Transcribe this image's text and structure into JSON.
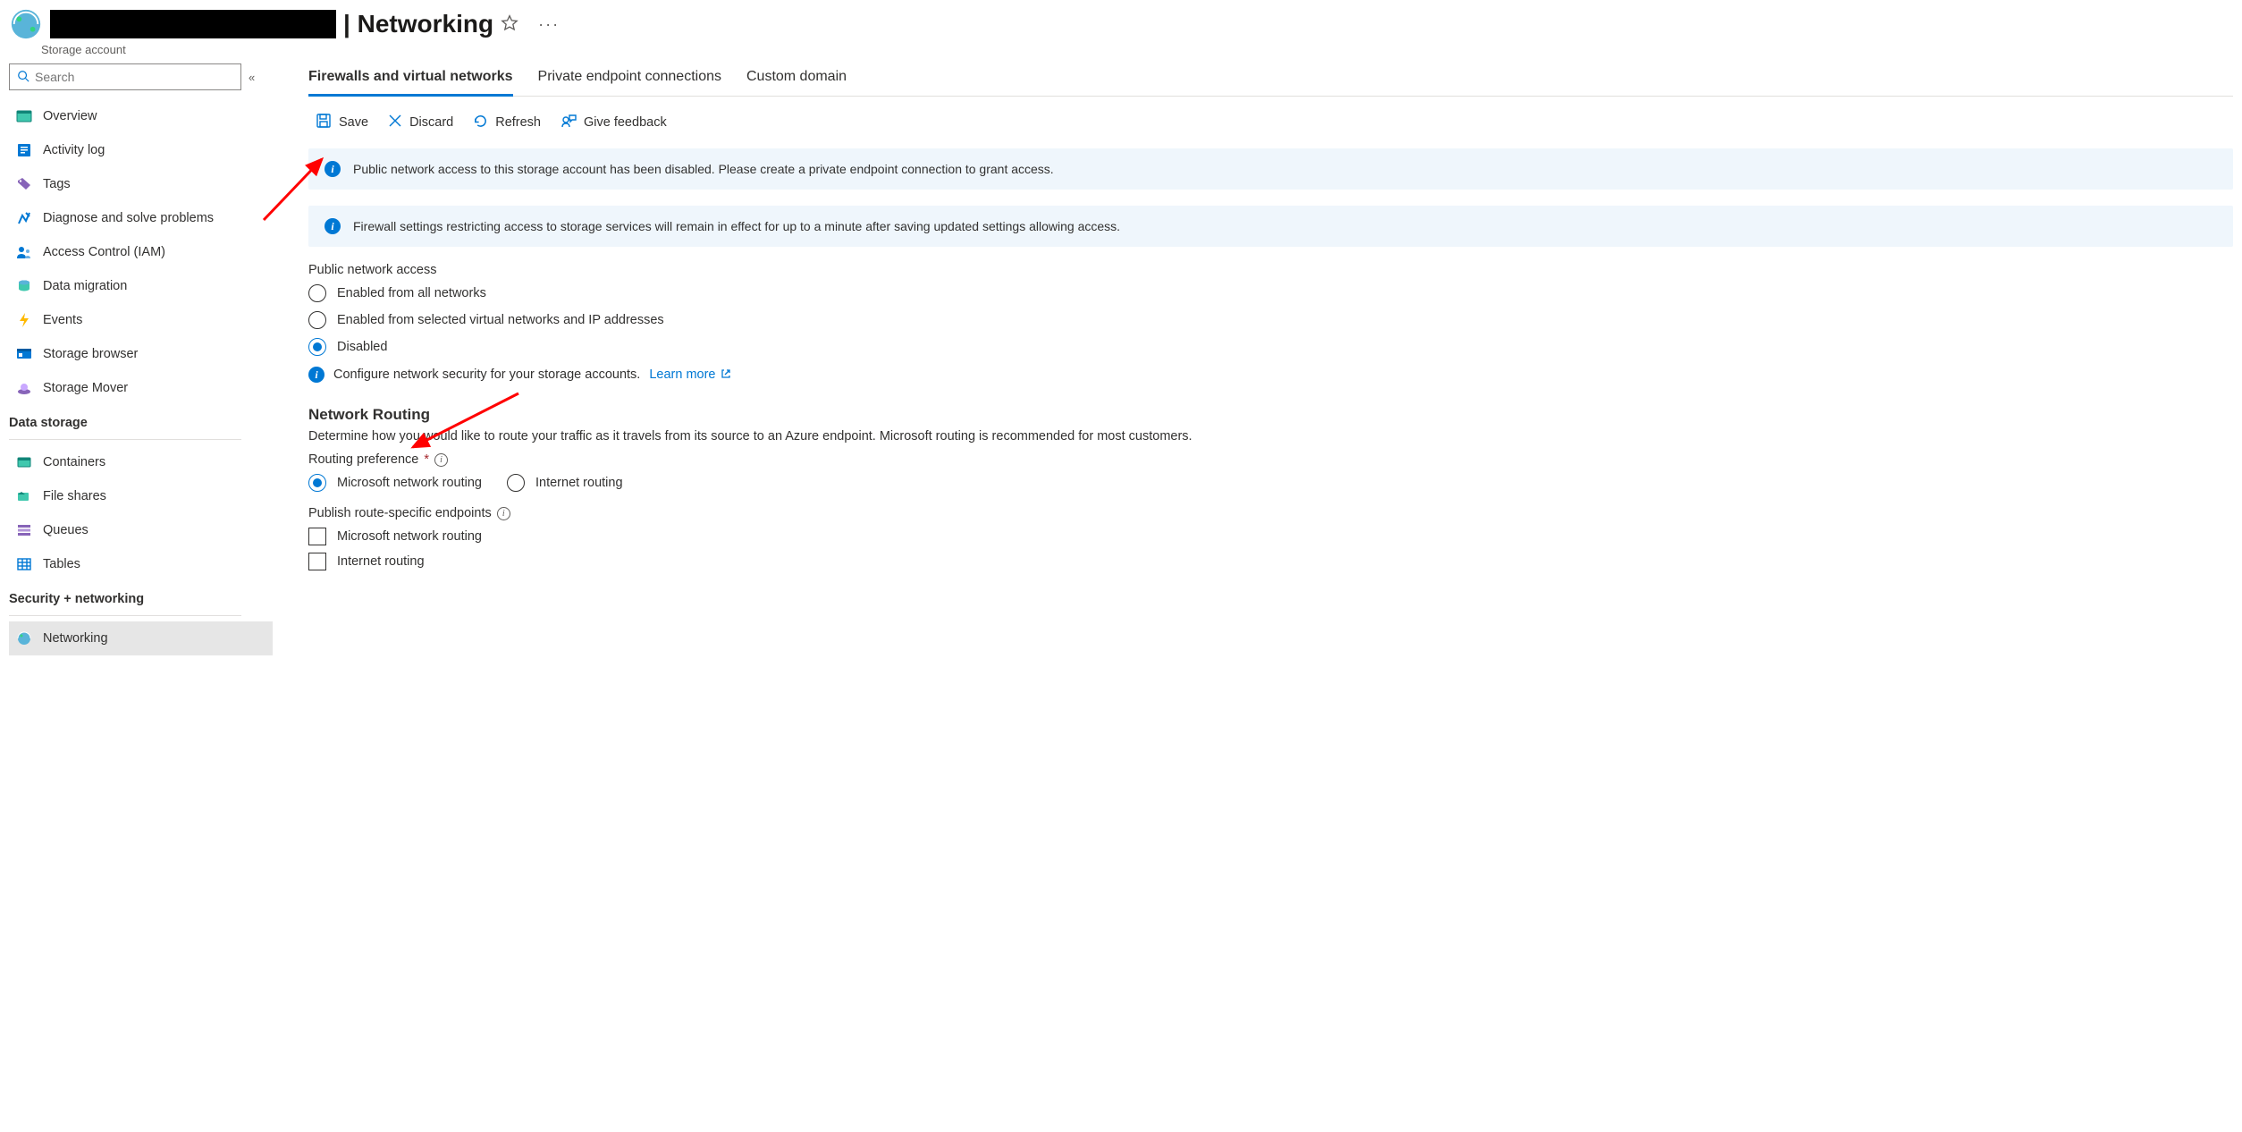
{
  "header": {
    "page_title_suffix": "| Networking",
    "subtitle": "Storage account"
  },
  "sidebar": {
    "search_placeholder": "Search",
    "items_top": [
      {
        "icon": "overview-icon",
        "label": "Overview"
      },
      {
        "icon": "activity-log-icon",
        "label": "Activity log"
      },
      {
        "icon": "tags-icon",
        "label": "Tags"
      },
      {
        "icon": "diagnose-icon",
        "label": "Diagnose and solve problems"
      },
      {
        "icon": "access-control-icon",
        "label": "Access Control (IAM)"
      },
      {
        "icon": "data-migration-icon",
        "label": "Data migration"
      },
      {
        "icon": "events-icon",
        "label": "Events"
      },
      {
        "icon": "storage-browser-icon",
        "label": "Storage browser"
      },
      {
        "icon": "storage-mover-icon",
        "label": "Storage Mover"
      }
    ],
    "section_data_storage": {
      "label": "Data storage",
      "items": [
        {
          "icon": "containers-icon",
          "label": "Containers"
        },
        {
          "icon": "file-shares-icon",
          "label": "File shares"
        },
        {
          "icon": "queues-icon",
          "label": "Queues"
        },
        {
          "icon": "tables-icon",
          "label": "Tables"
        }
      ]
    },
    "section_security": {
      "label": "Security + networking",
      "items": [
        {
          "icon": "networking-icon",
          "label": "Networking",
          "selected": true
        }
      ]
    }
  },
  "tabs": [
    {
      "label": "Firewalls and virtual networks",
      "active": true
    },
    {
      "label": "Private endpoint connections",
      "active": false
    },
    {
      "label": "Custom domain",
      "active": false
    }
  ],
  "toolbar": {
    "save_label": "Save",
    "discard_label": "Discard",
    "refresh_label": "Refresh",
    "feedback_label": "Give feedback"
  },
  "info_banners": {
    "banner1": "Public network access to this storage account has been disabled. Please create a private endpoint connection to grant access.",
    "banner2": "Firewall settings restricting access to storage services will remain in effect for up to a minute after saving updated settings allowing access."
  },
  "public_access": {
    "label": "Public network access",
    "options": [
      {
        "label": "Enabled from all networks",
        "checked": false
      },
      {
        "label": "Enabled from selected virtual networks and IP addresses",
        "checked": false
      },
      {
        "label": "Disabled",
        "checked": true
      }
    ],
    "help_text": "Configure network security for your storage accounts.",
    "learn_more": "Learn more"
  },
  "routing": {
    "heading": "Network Routing",
    "desc": "Determine how you would like to route your traffic as it travels from its source to an Azure endpoint. Microsoft routing is recommended for most customers.",
    "pref_label": "Routing preference",
    "options": [
      {
        "label": "Microsoft network routing",
        "checked": true
      },
      {
        "label": "Internet routing",
        "checked": false
      }
    ],
    "publish_label": "Publish route-specific endpoints",
    "publish_options": [
      {
        "label": "Microsoft network routing",
        "checked": false
      },
      {
        "label": "Internet routing",
        "checked": false
      }
    ]
  }
}
